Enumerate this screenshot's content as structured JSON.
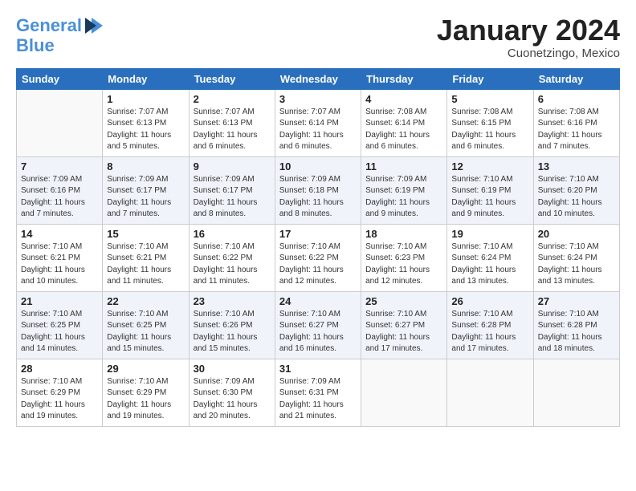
{
  "header": {
    "logo_line1": "General",
    "logo_line2": "Blue",
    "month": "January 2024",
    "location": "Cuonetzingo, Mexico"
  },
  "days_of_week": [
    "Sunday",
    "Monday",
    "Tuesday",
    "Wednesday",
    "Thursday",
    "Friday",
    "Saturday"
  ],
  "weeks": [
    [
      {
        "day": "",
        "text": ""
      },
      {
        "day": "1",
        "text": "Sunrise: 7:07 AM\nSunset: 6:13 PM\nDaylight: 11 hours\nand 5 minutes."
      },
      {
        "day": "2",
        "text": "Sunrise: 7:07 AM\nSunset: 6:13 PM\nDaylight: 11 hours\nand 6 minutes."
      },
      {
        "day": "3",
        "text": "Sunrise: 7:07 AM\nSunset: 6:14 PM\nDaylight: 11 hours\nand 6 minutes."
      },
      {
        "day": "4",
        "text": "Sunrise: 7:08 AM\nSunset: 6:14 PM\nDaylight: 11 hours\nand 6 minutes."
      },
      {
        "day": "5",
        "text": "Sunrise: 7:08 AM\nSunset: 6:15 PM\nDaylight: 11 hours\nand 6 minutes."
      },
      {
        "day": "6",
        "text": "Sunrise: 7:08 AM\nSunset: 6:16 PM\nDaylight: 11 hours\nand 7 minutes."
      }
    ],
    [
      {
        "day": "7",
        "text": "Sunrise: 7:09 AM\nSunset: 6:16 PM\nDaylight: 11 hours\nand 7 minutes."
      },
      {
        "day": "8",
        "text": "Sunrise: 7:09 AM\nSunset: 6:17 PM\nDaylight: 11 hours\nand 7 minutes."
      },
      {
        "day": "9",
        "text": "Sunrise: 7:09 AM\nSunset: 6:17 PM\nDaylight: 11 hours\nand 8 minutes."
      },
      {
        "day": "10",
        "text": "Sunrise: 7:09 AM\nSunset: 6:18 PM\nDaylight: 11 hours\nand 8 minutes."
      },
      {
        "day": "11",
        "text": "Sunrise: 7:09 AM\nSunset: 6:19 PM\nDaylight: 11 hours\nand 9 minutes."
      },
      {
        "day": "12",
        "text": "Sunrise: 7:10 AM\nSunset: 6:19 PM\nDaylight: 11 hours\nand 9 minutes."
      },
      {
        "day": "13",
        "text": "Sunrise: 7:10 AM\nSunset: 6:20 PM\nDaylight: 11 hours\nand 10 minutes."
      }
    ],
    [
      {
        "day": "14",
        "text": "Sunrise: 7:10 AM\nSunset: 6:21 PM\nDaylight: 11 hours\nand 10 minutes."
      },
      {
        "day": "15",
        "text": "Sunrise: 7:10 AM\nSunset: 6:21 PM\nDaylight: 11 hours\nand 11 minutes."
      },
      {
        "day": "16",
        "text": "Sunrise: 7:10 AM\nSunset: 6:22 PM\nDaylight: 11 hours\nand 11 minutes."
      },
      {
        "day": "17",
        "text": "Sunrise: 7:10 AM\nSunset: 6:22 PM\nDaylight: 11 hours\nand 12 minutes."
      },
      {
        "day": "18",
        "text": "Sunrise: 7:10 AM\nSunset: 6:23 PM\nDaylight: 11 hours\nand 12 minutes."
      },
      {
        "day": "19",
        "text": "Sunrise: 7:10 AM\nSunset: 6:24 PM\nDaylight: 11 hours\nand 13 minutes."
      },
      {
        "day": "20",
        "text": "Sunrise: 7:10 AM\nSunset: 6:24 PM\nDaylight: 11 hours\nand 13 minutes."
      }
    ],
    [
      {
        "day": "21",
        "text": "Sunrise: 7:10 AM\nSunset: 6:25 PM\nDaylight: 11 hours\nand 14 minutes."
      },
      {
        "day": "22",
        "text": "Sunrise: 7:10 AM\nSunset: 6:25 PM\nDaylight: 11 hours\nand 15 minutes."
      },
      {
        "day": "23",
        "text": "Sunrise: 7:10 AM\nSunset: 6:26 PM\nDaylight: 11 hours\nand 15 minutes."
      },
      {
        "day": "24",
        "text": "Sunrise: 7:10 AM\nSunset: 6:27 PM\nDaylight: 11 hours\nand 16 minutes."
      },
      {
        "day": "25",
        "text": "Sunrise: 7:10 AM\nSunset: 6:27 PM\nDaylight: 11 hours\nand 17 minutes."
      },
      {
        "day": "26",
        "text": "Sunrise: 7:10 AM\nSunset: 6:28 PM\nDaylight: 11 hours\nand 17 minutes."
      },
      {
        "day": "27",
        "text": "Sunrise: 7:10 AM\nSunset: 6:28 PM\nDaylight: 11 hours\nand 18 minutes."
      }
    ],
    [
      {
        "day": "28",
        "text": "Sunrise: 7:10 AM\nSunset: 6:29 PM\nDaylight: 11 hours\nand 19 minutes."
      },
      {
        "day": "29",
        "text": "Sunrise: 7:10 AM\nSunset: 6:29 PM\nDaylight: 11 hours\nand 19 minutes."
      },
      {
        "day": "30",
        "text": "Sunrise: 7:09 AM\nSunset: 6:30 PM\nDaylight: 11 hours\nand 20 minutes."
      },
      {
        "day": "31",
        "text": "Sunrise: 7:09 AM\nSunset: 6:31 PM\nDaylight: 11 hours\nand 21 minutes."
      },
      {
        "day": "",
        "text": ""
      },
      {
        "day": "",
        "text": ""
      },
      {
        "day": "",
        "text": ""
      }
    ]
  ]
}
